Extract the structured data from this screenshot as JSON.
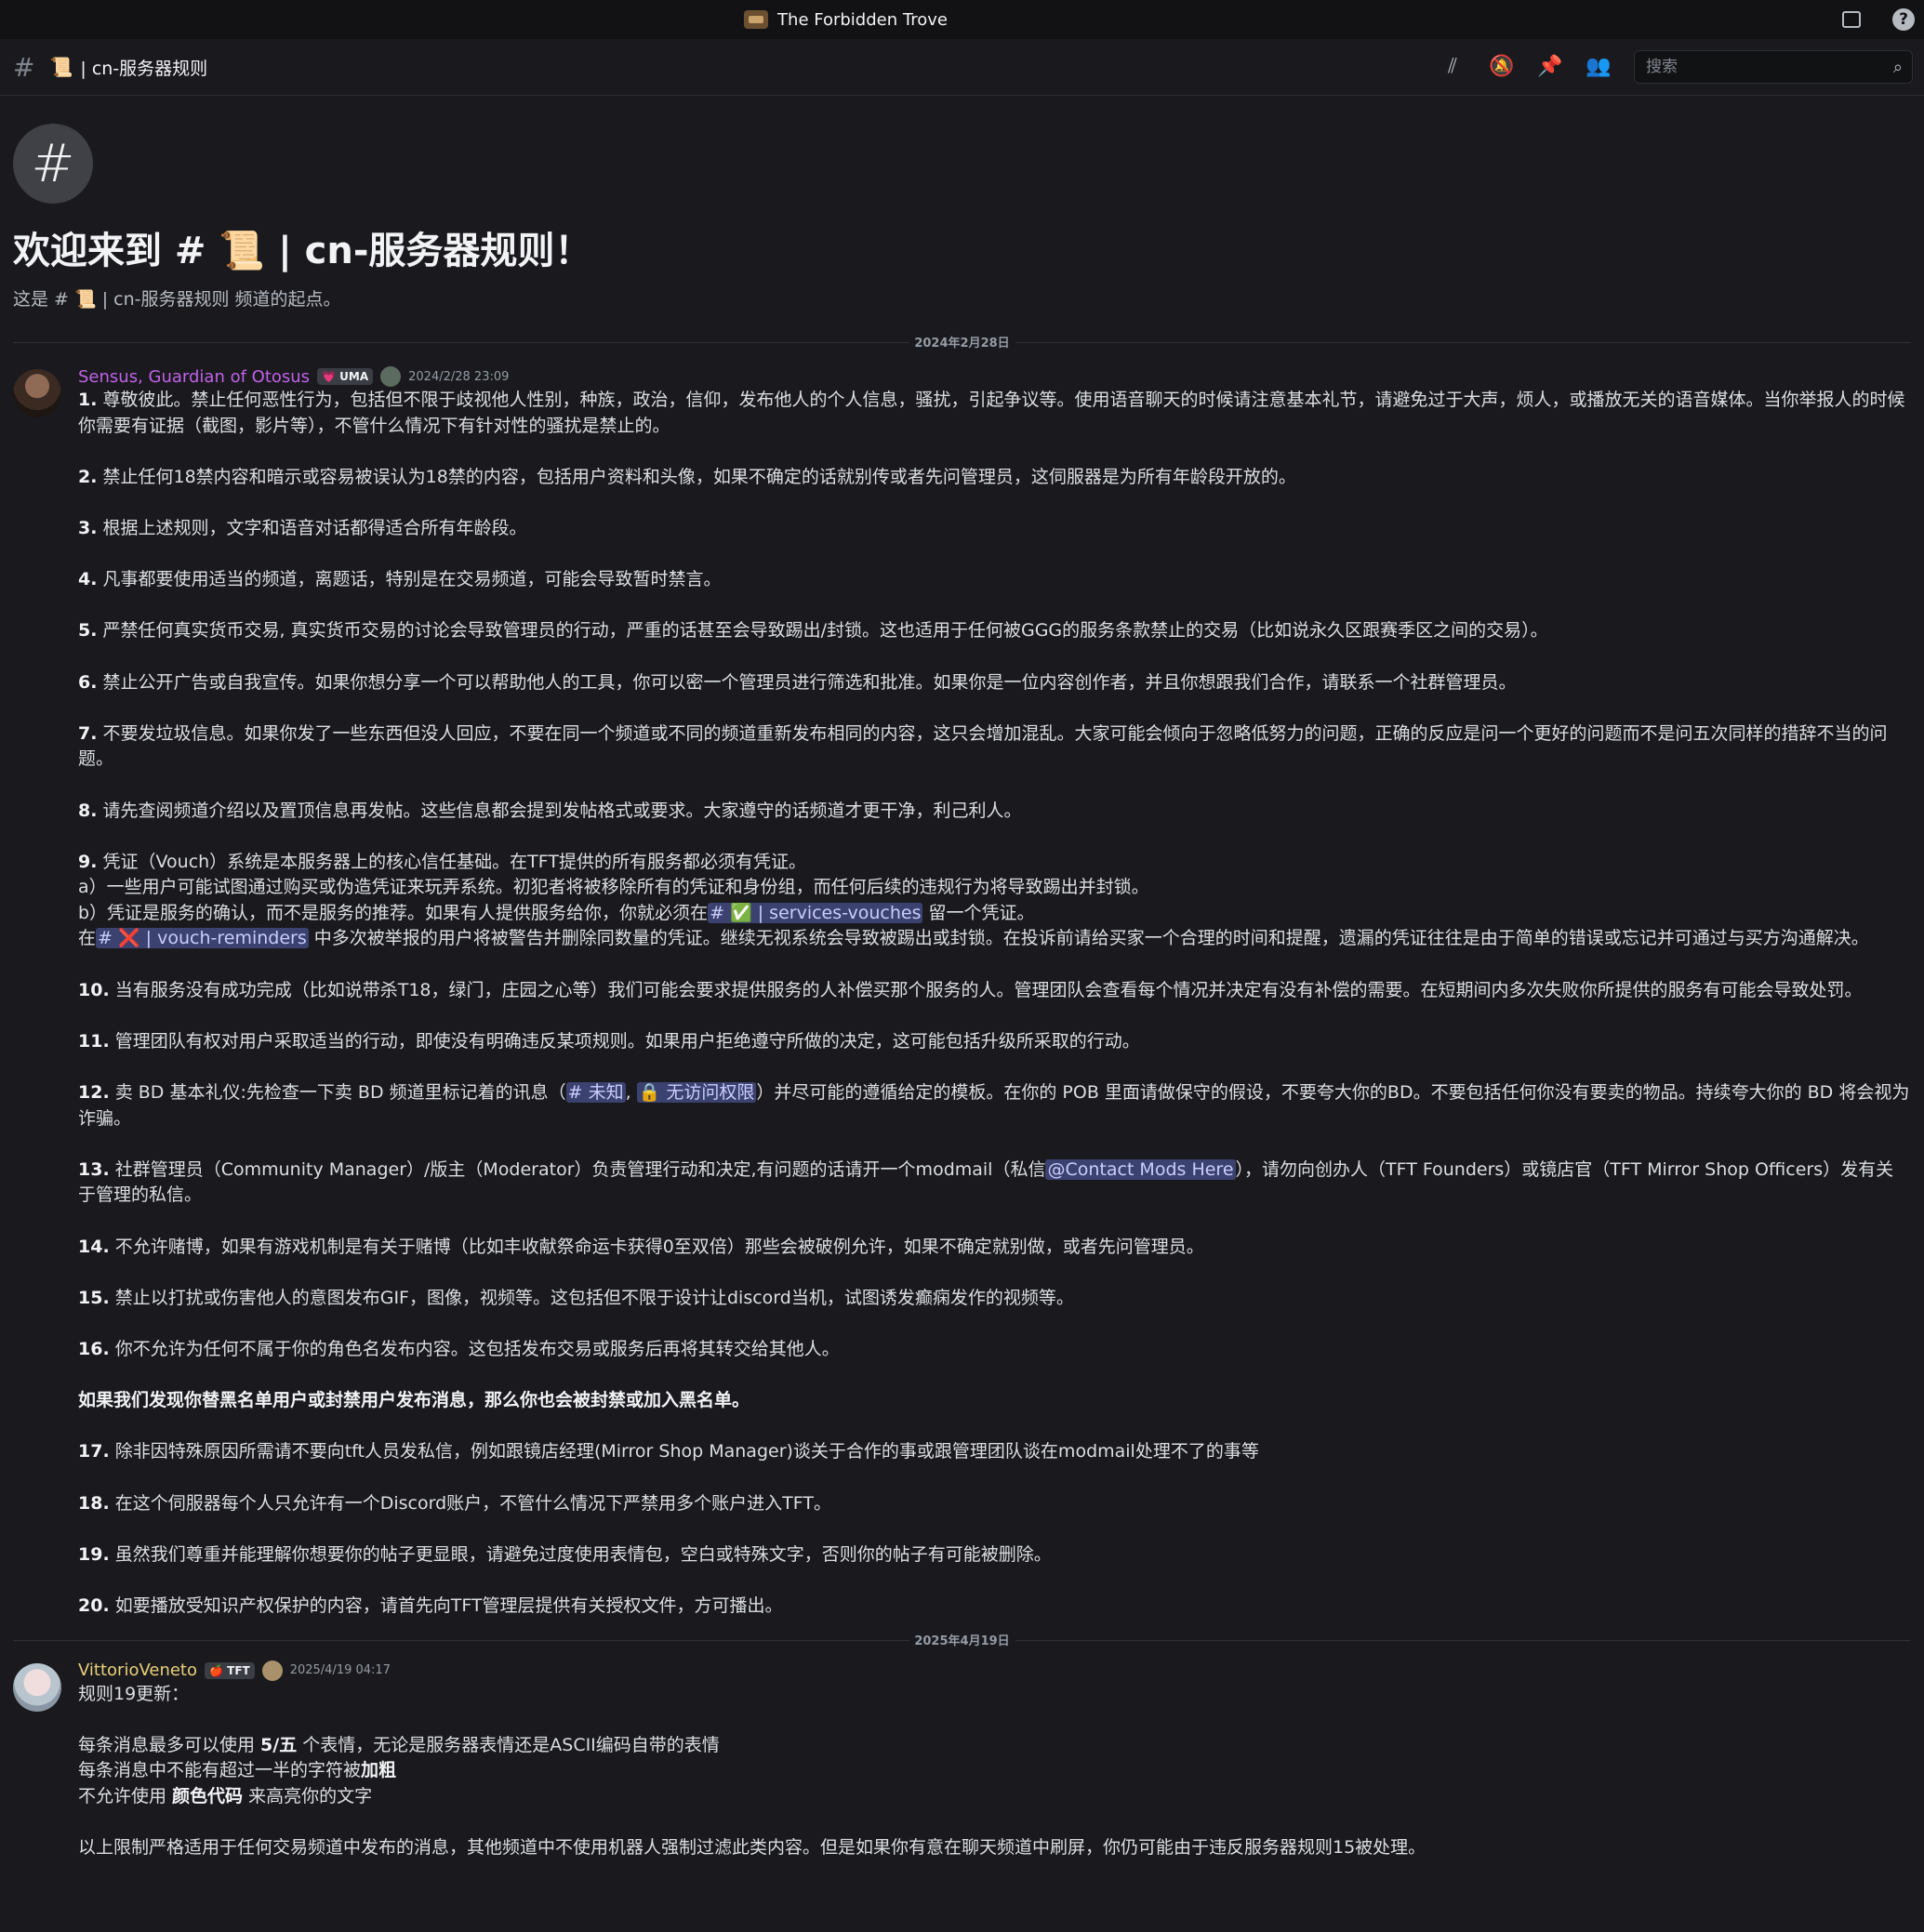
{
  "titlebar": {
    "app_name": "The Forbidden Trove"
  },
  "header": {
    "hash": "#",
    "channel_emoji": "📜",
    "channel_name": "| cn-服务器规则",
    "search_placeholder": "搜索"
  },
  "welcome": {
    "hash": "#",
    "title": "欢迎来到 # 📜 | cn-服务器规则！",
    "subtitle": "这是 # 📜 | cn-服务器规则 频道的起点。"
  },
  "dividers": [
    "2024年2月28日",
    "2025年4月19日"
  ],
  "messages": [
    {
      "author": "Sensus, Guardian of Otosus",
      "author_color": "#c061e8",
      "tag": "💗 UMA",
      "timestamp": "2024/2/28 23:09",
      "rules": [
        {
          "num": "1.",
          "text": "尊敬彼此。禁止任何恶性行为，包括但不限于歧视他人性别，种族，政治，信仰，发布他人的个人信息，骚扰，引起争议等。使用语音聊天的时候请注意基本礼节，请避免过于大声，烦人，或播放无关的语音媒体。当你举报人的时候你需要有证据（截图，影片等），不管什么情况下有针对性的骚扰是禁止的。"
        },
        {
          "num": "2.",
          "text": "禁止任何18禁内容和暗示或容易被误认为18禁的内容，包括用户资料和头像，如果不确定的话就别传或者先问管理员，这伺服器是为所有年龄段开放的。"
        },
        {
          "num": "3.",
          "text": "根据上述规则，文字和语音对话都得适合所有年龄段。"
        },
        {
          "num": "4.",
          "text": "凡事都要使用适当的频道，离题话，特别是在交易频道，可能会导致暂时禁言。"
        },
        {
          "num": "5.",
          "text": "严禁任何真实货币交易, 真实货币交易的讨论会导致管理员的行动，严重的话甚至会导致踢出/封锁。这也适用于任何被GGG的服务条款禁止的交易（比如说永久区跟赛季区之间的交易）。"
        },
        {
          "num": "6.",
          "text": "禁止公开广告或自我宣传。如果你想分享一个可以帮助他人的工具，你可以密一个管理员进行筛选和批准。如果你是一位内容创作者，并且你想跟我们合作，请联系一个社群管理员。"
        },
        {
          "num": "7.",
          "text": "不要发垃圾信息。如果你发了一些东西但没人回应，不要在同一个频道或不同的频道重新发布相同的内容，这只会增加混乱。大家可能会倾向于忽略低努力的问题，正确的反应是问一个更好的问题而不是问五次同样的措辞不当的问题。"
        },
        {
          "num": "8.",
          "text": "请先查阅频道介绍以及置顶信息再发帖。这些信息都会提到发帖格式或要求。大家遵守的话频道才更干净，利己利人。"
        }
      ],
      "rule9": {
        "num": "9.",
        "line1": "凭证（Vouch）系统是本服务器上的核心信任基础。在TFT提供的所有服务都必须有凭证。",
        "line_a": "a）一些用户可能试图通过购买或伪造凭证来玩弄系统。初犯者将被移除所有的凭证和身份组，而任何后续的违规行为将导致踢出并封锁。",
        "line_b_pre": "b）凭证是服务的确认，而不是服务的推荐。如果有人提供服务给你，你就必须在",
        "mention_vouches": "# ✅ | services-vouches",
        "line_b_post": " 留一个凭证。",
        "line_c_pre": "在",
        "mention_reminders": "# ❌ | vouch-reminders",
        "line_c_post": " 中多次被举报的用户将被警告并删除同数量的凭证。继续无视系统会导致被踢出或封锁。在投诉前请给买家一个合理的时间和提醒，遗漏的凭证往往是由于简单的错误或忘记并可通过与买方沟通解决。"
      },
      "rules_b": [
        {
          "num": "10.",
          "text": "当有服务没有成功完成（比如说带杀T18，绿门，庄园之心等）我们可能会要求提供服务的人补偿买那个服务的人。管理团队会查看每个情况并决定有没有补偿的需要。在短期间内多次失败你所提供的服务有可能会导致处罚。"
        },
        {
          "num": "11.",
          "text": "管理团队有权对用户采取适当的行动，即使没有明确违反某项规则。如果用户拒绝遵守所做的决定，这可能包括升级所采取的行动。"
        }
      ],
      "rule12": {
        "num": "12.",
        "pre": "卖 BD 基本礼仪:先检查一下卖 BD 频道里标记着的讯息（",
        "mention_unknown": "# 未知",
        "sep": ", ",
        "mention_noaccess": "🔒 无访问权限",
        "post": "）并尽可能的遵循给定的模板。在你的 POB 里面请做保守的假设，不要夸大你的BD。不要包括任何你没有要卖的物品。持续夸大你的 BD 将会视为诈骗。"
      },
      "rule13": {
        "num": "13.",
        "pre": "社群管理员（Community Manager）/版主（Moderator）负责管理行动和决定,有问题的话请开一个modmail（私信",
        "mention": "@Contact Mods Here",
        "post": "），请勿向创办人（TFT Founders）或镜店官（TFT Mirror Shop Officers）发有关于管理的私信。"
      },
      "rules_c": [
        {
          "num": "14.",
          "text": "不允许赌博，如果有游戏机制是有关于赌博（比如丰收献祭命运卡获得0至双倍）那些会被破例允许，如果不确定就别做，或者先问管理员。"
        },
        {
          "num": "15.",
          "text": "禁止以打扰或伤害他人的意图发布GIF，图像，视频等。这包括但不限于设计让discord当机，试图诱发癫痫发作的视频等。"
        },
        {
          "num": "16.",
          "text": "你不允许为任何不属于你的角色名发布内容。这包括发布交易或服务后再将其转交给其他人。"
        }
      ],
      "bold_notice": "如果我们发现你替黑名单用户或封禁用户发布消息，那么你也会被封禁或加入黑名单。",
      "rules_d": [
        {
          "num": "17.",
          "text": "除非因特殊原因所需请不要向tft人员发私信，例如跟镜店经理(Mirror Shop Manager)谈关于合作的事或跟管理团队谈在modmail处理不了的事等"
        },
        {
          "num": "18.",
          "text": "在这个伺服器每个人只允许有一个Discord账户，不管什么情况下严禁用多个账户进入TFT。"
        },
        {
          "num": "19.",
          "text": "虽然我们尊重并能理解你想要你的帖子更显眼，请避免过度使用表情包，空白或特殊文字，否则你的帖子有可能被删除。"
        },
        {
          "num": "20.",
          "text": "如要播放受知识产权保护的内容，请首先向TFT管理层提供有关授权文件，方可播出。"
        }
      ]
    },
    {
      "author": "VittorioVeneto",
      "author_color": "#e9d07a",
      "tag": "🍎 TFT",
      "timestamp": "2025/4/19 04:17",
      "line1": "规则19更新：",
      "line2_pre": "每条消息最多可以使用 ",
      "line2_bold": "5/五",
      "line2_post": " 个表情，无论是服务器表情还是ASCII编码自带的表情",
      "line3_pre": "每条消息中不能有超过一半的字符被",
      "line3_bold": "加粗",
      "line4_pre": "不允许使用 ",
      "line4_bold": "颜色代码",
      "line4_post": " 来高亮你的文字",
      "line5": "以上限制严格适用于任何交易频道中发布的消息，其他频道中不使用机器人强制过滤此类内容。但是如果你有意在聊天频道中刷屏，你仍可能由于违反服务器规则15被处理。"
    }
  ],
  "icons": {
    "threads": "threads-icon",
    "mute": "bell-slash-icon",
    "pin": "pin-icon",
    "members": "members-icon",
    "search": "search-icon",
    "inbox": "inbox-icon",
    "help": "help-icon"
  }
}
